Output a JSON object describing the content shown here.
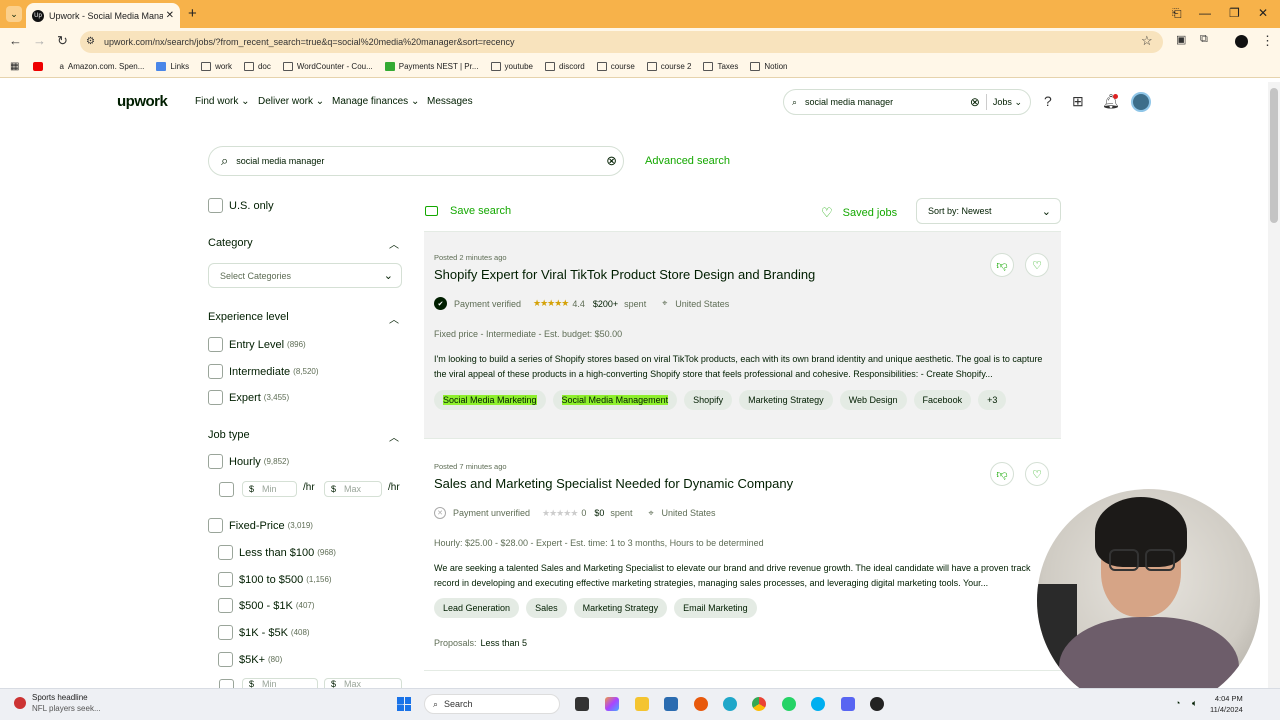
{
  "browser": {
    "tab_title": "Upwork - Social Media Manager",
    "tab_favicon": "Up",
    "url": "upwork.com/nx/search/jobs/?from_recent_search=true&q=social%20media%20manager&sort=recency",
    "bookmarks": [
      "Amazon.com. Spen...",
      "Links",
      "work",
      "doc",
      "WordCounter - Cou...",
      "Payments NEST | Pr...",
      "youtube",
      "discord",
      "course",
      "course 2",
      "Taxes",
      "Notion"
    ]
  },
  "header": {
    "logo": "upwork",
    "nav": [
      "Find work",
      "Deliver work",
      "Manage finances",
      "Messages"
    ],
    "search_value": "social media manager",
    "search_scope": "Jobs"
  },
  "search": {
    "value": "social media manager",
    "advanced": "Advanced search"
  },
  "filters": {
    "us_only": "U.S. only",
    "category": {
      "title": "Category",
      "placeholder": "Select Categories"
    },
    "experience": {
      "title": "Experience level",
      "items": [
        {
          "label": "Entry Level",
          "count": "(896)"
        },
        {
          "label": "Intermediate",
          "count": "(8,520)"
        },
        {
          "label": "Expert",
          "count": "(3,455)"
        }
      ]
    },
    "job_type": {
      "title": "Job type",
      "hourly": {
        "label": "Hourly",
        "count": "(9,852)"
      },
      "min": "Min",
      "max": "Max",
      "currency": "$",
      "per_hr": "/hr",
      "fixed": {
        "label": "Fixed-Price",
        "count": "(3,019)"
      },
      "fixed_items": [
        {
          "label": "Less than $100",
          "count": "(968)"
        },
        {
          "label": "$100 to $500",
          "count": "(1,156)"
        },
        {
          "label": "$500 - $1K",
          "count": "(407)"
        },
        {
          "label": "$1K - $5K",
          "count": "(408)"
        },
        {
          "label": "$5K+",
          "count": "(80)"
        }
      ]
    }
  },
  "toolbar": {
    "save_search": "Save search",
    "saved_jobs": "Saved jobs",
    "sort": "Sort by: Newest"
  },
  "jobs": [
    {
      "posted": "Posted 2 minutes ago",
      "title": "Shopify Expert for Viral TikTok Product Store Design and Branding",
      "payment": "Payment verified",
      "rating": "4.4",
      "spent_amount": "$200+",
      "spent_label": "spent",
      "location": "United States",
      "budget": "Fixed price - Intermediate - Est. budget: $50.00",
      "description": "I'm looking to build a series of Shopify stores based on viral TikTok products, each with its own brand identity and unique aesthetic. The goal is to capture the viral appeal of these products in a high-converting Shopify store that feels professional and cohesive. Responsibilities: - Create Shopify...",
      "tags": [
        "Social Media Marketing",
        "Social Media Management",
        "Shopify",
        "Marketing Strategy",
        "Web Design",
        "Facebook",
        "+3"
      ]
    },
    {
      "posted": "Posted 7 minutes ago",
      "title": "Sales and Marketing Specialist Needed for Dynamic Company",
      "payment": "Payment unverified",
      "rating": "0",
      "spent_amount": "$0",
      "spent_label": "spent",
      "location": "United States",
      "budget": "Hourly: $25.00 - $28.00 - Expert - Est. time: 1 to 3 months, Hours to be determined",
      "description": "We are seeking a talented Sales and Marketing Specialist to elevate our brand and drive revenue growth. The ideal candidate will have a proven track record in developing and executing effective marketing strategies, managing sales processes, and leveraging digital marketing tools. Your...",
      "tags": [
        "Lead Generation",
        "Sales",
        "Marketing Strategy",
        "Email Marketing"
      ],
      "proposals_label": "Proposals:",
      "proposals_value": "Less than 5"
    }
  ],
  "taskbar": {
    "news_title": "Sports headline",
    "news_sub": "NFL players seek...",
    "search": "Search",
    "time": "4:04 PM",
    "date": "11/4/2024"
  },
  "colors": {
    "brand_green": "#14a800",
    "tab_bar": "#f7b24a",
    "highlight": "#8ef02c"
  }
}
